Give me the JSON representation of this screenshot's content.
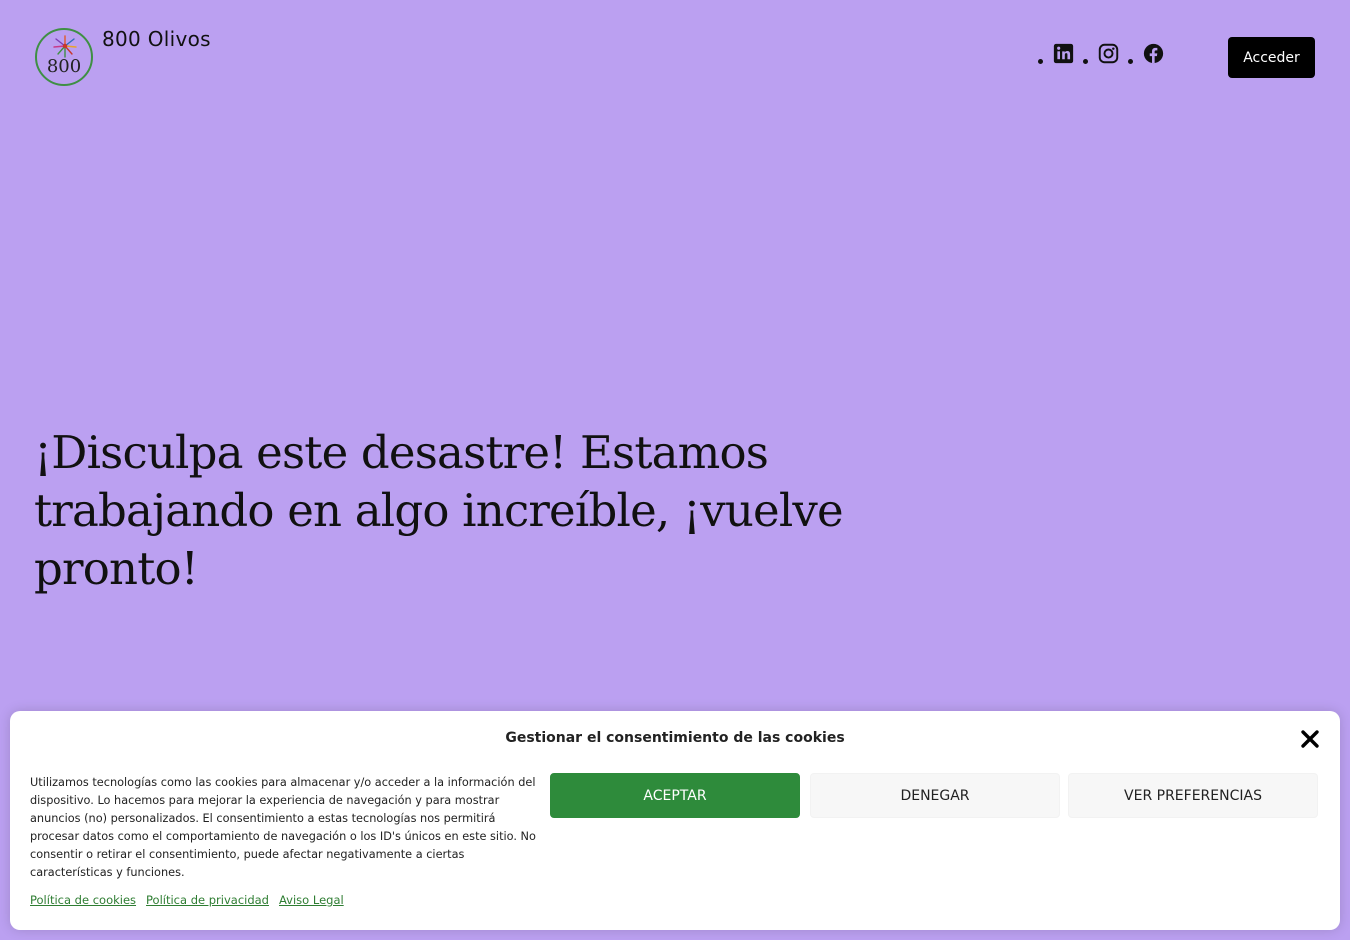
{
  "header": {
    "logo_text": "800",
    "site_title": "800 Olivos",
    "social_icons": [
      "linkedin-icon",
      "instagram-icon",
      "facebook-icon"
    ],
    "login_label": "Acceder"
  },
  "main": {
    "headline": "¡Disculpa este desastre! Estamos trabajando en algo increíble, ¡vuelve pronto!"
  },
  "cookie_banner": {
    "title": "Gestionar el consentimiento de las cookies",
    "message": "Utilizamos tecnologías como las cookies para almacenar y/o acceder a la información del dispositivo. Lo hacemos para mejorar la experiencia de navegación y para mostrar anuncios (no) personalizados. El consentimiento a estas tecnologías nos permitirá procesar datos como el comportamiento de navegación o los ID's únicos en este sitio. No consentir o retirar el consentimiento, puede afectar negativamente a ciertas características y funciones.",
    "accept_label": "ACEPTAR",
    "deny_label": "DENEGAR",
    "preferences_label": "VER PREFERENCIAS",
    "links": {
      "cookies": "Política de cookies",
      "privacy": "Política de privacidad",
      "legal": "Aviso Legal"
    }
  },
  "colors": {
    "background": "#bba0f1",
    "accept_button": "#2e8b3b",
    "login_button": "#000000",
    "link": "#2e7d32"
  }
}
